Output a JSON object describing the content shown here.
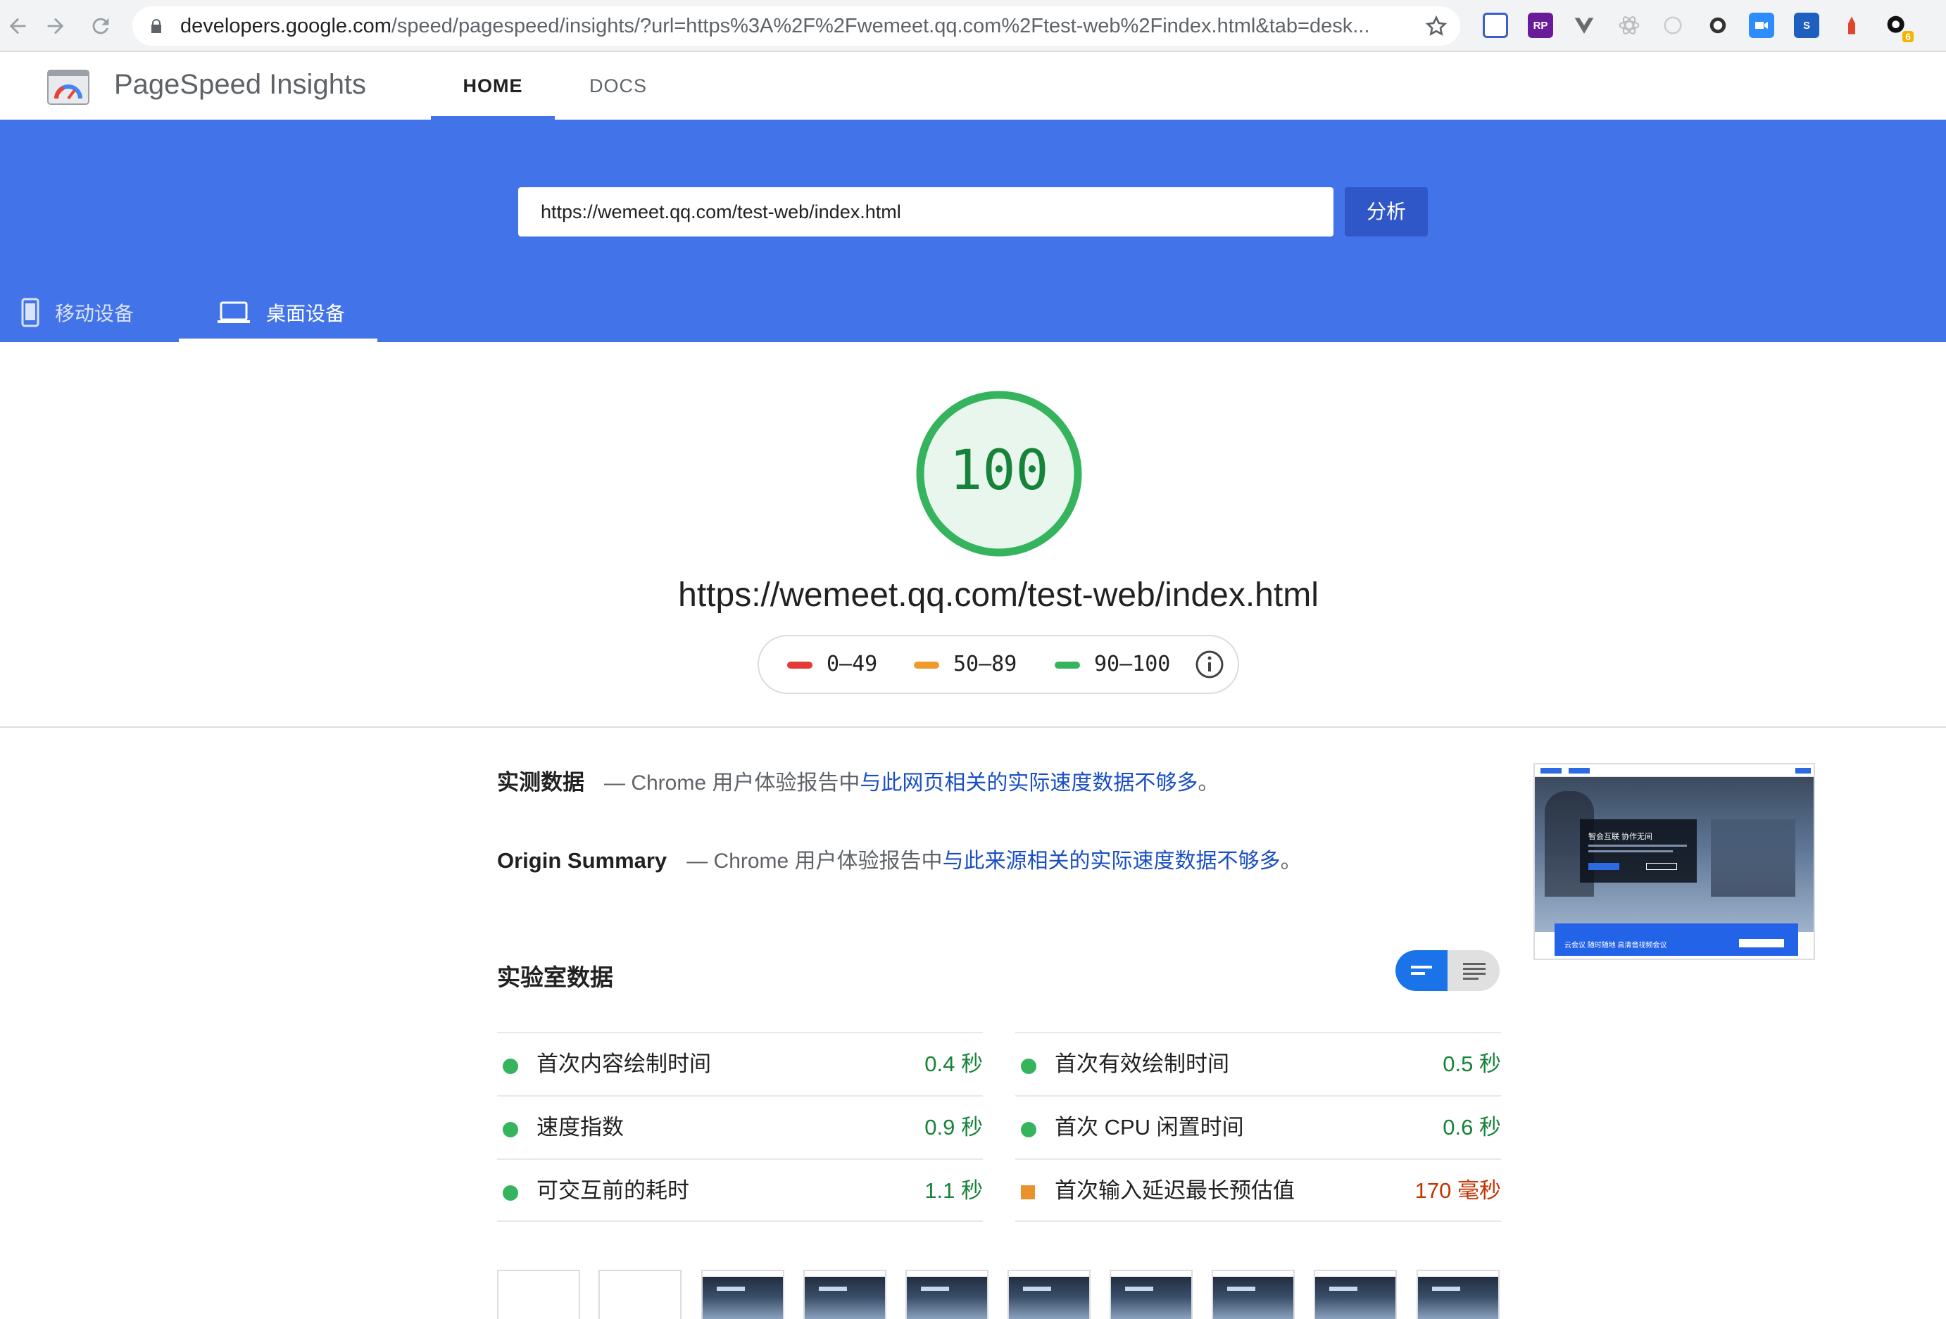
{
  "browser": {
    "url_host": "developers.google.com",
    "url_path": "/speed/pagespeed/insights/?url=https%3A%2F%2Fwemeet.qq.com%2Ftest-web%2Findex.html&tab=desk...",
    "extensions": [
      "ext-1",
      "ext-rp",
      "ext-v",
      "ext-react",
      "ext-6",
      "ext-7",
      "ext-zoom",
      "ext-s",
      "ext-9",
      "ext-10"
    ],
    "badge_count": "6"
  },
  "app": {
    "title": "PageSpeed Insights",
    "nav": [
      {
        "label": "HOME",
        "active": true
      },
      {
        "label": "DOCS",
        "active": false
      }
    ]
  },
  "search": {
    "value": "https://wemeet.qq.com/test-web/index.html",
    "button_label": "分析"
  },
  "device_tabs": [
    {
      "label": "移动设备",
      "active": false
    },
    {
      "label": "桌面设备",
      "active": true
    }
  ],
  "score": {
    "value": 100,
    "display": "100",
    "tested_url": "https://wemeet.qq.com/test-web/index.html"
  },
  "legend": [
    {
      "label": "0–49",
      "color": "#e53935"
    },
    {
      "label": "50–89",
      "color": "#ef9a2b"
    },
    {
      "label": "90–100",
      "color": "#35b45d"
    }
  ],
  "field_data": {
    "heading": "实测数据",
    "text_prefix": "— Chrome 用户体验报告中",
    "link_text": "与此网页相关的实际速度数据不够多",
    "text_suffix": "。"
  },
  "origin_summary": {
    "heading": "Origin Summary",
    "text_prefix": "— Chrome 用户体验报告中",
    "link_text": "与此来源相关的实际速度数据不够多",
    "text_suffix": "。"
  },
  "lab_data": {
    "heading": "实验室数据",
    "metrics_left": [
      {
        "label": "首次内容绘制时间",
        "value": "0.4 秒",
        "status": "good"
      },
      {
        "label": "速度指数",
        "value": "0.9 秒",
        "status": "good"
      },
      {
        "label": "可交互前的耗时",
        "value": "1.1 秒",
        "status": "good"
      }
    ],
    "metrics_right": [
      {
        "label": "首次有效绘制时间",
        "value": "0.5 秒",
        "status": "good"
      },
      {
        "label": "首次 CPU 闲置时间",
        "value": "0.6 秒",
        "status": "good"
      },
      {
        "label": "首次输入延迟最长预估值",
        "value": "170 毫秒",
        "status": "average"
      }
    ]
  },
  "final_screenshot": {
    "hero_title": "智会互联 协作无间",
    "banner_text": "云会议 随时随地 高清音视频会议"
  },
  "filmstrip": {
    "frames_total": 10,
    "frames_blank": 2
  }
}
